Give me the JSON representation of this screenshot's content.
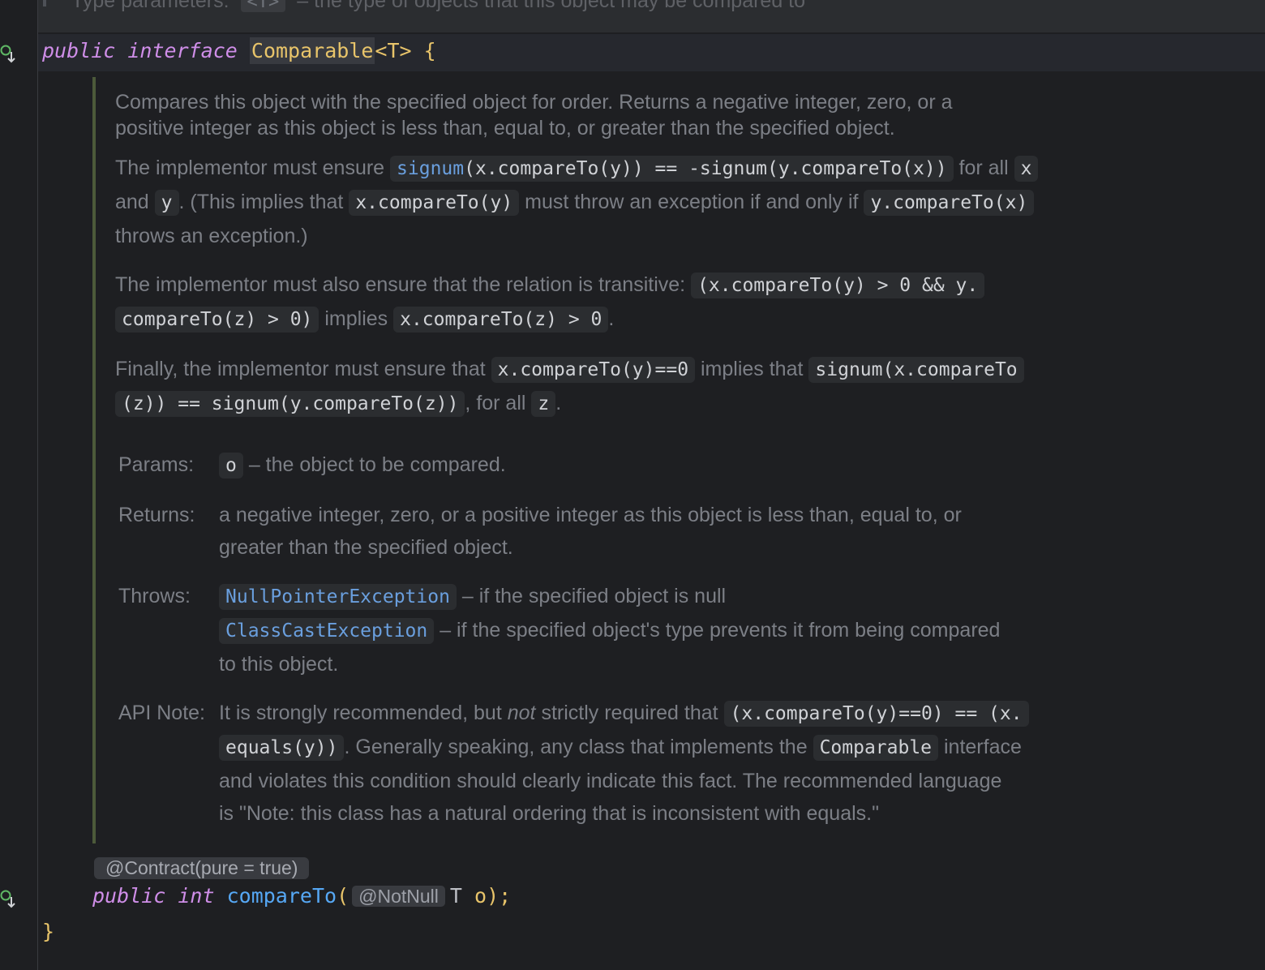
{
  "header": {
    "type_params_label": "Type parameters:",
    "type_params_code": "<T>",
    "type_params_desc": "– the type of objects that this object may be compared to"
  },
  "decl": {
    "kw_public": "public",
    "kw_interface": "interface",
    "class_name": "Comparable",
    "type_param": "<T>",
    "open_brace": "{"
  },
  "doc": {
    "p1_line1": "Compares this object with the specified object for order. Returns a negative integer, zero, or a",
    "p1_line2": "positive integer as this object is less than, equal to, or greater than the specified object.",
    "p2": {
      "t1": "The implementor must ensure",
      "c1_link": "signum",
      "c1_rest": "(x.compareTo(y)) == -signum(y.compareTo(x))",
      "t2": "for all",
      "c2": "x",
      "t3": "and",
      "c3": "y",
      "t4": ". (This implies that",
      "c4": "x.compareTo(y)",
      "t5": "must throw an exception if and only if",
      "c5": "y.compareTo(x)",
      "t6": "throws an exception.)"
    },
    "p3": {
      "t1": "The implementor must also ensure that the relation is transitive:",
      "c1a": "(x.compareTo(y) > 0 && y.",
      "c1b": "compareTo(z) > 0)",
      "t2": "implies",
      "c2": "x.compareTo(z) > 0",
      "t3": "."
    },
    "p4": {
      "t1": "Finally, the implementor must ensure that",
      "c1": "x.compareTo(y)==0",
      "t2": "implies that",
      "c2a": "signum(x.compareTo",
      "c2b": "(z)) == signum(y.compareTo(z))",
      "t3": ", for all",
      "c3": "z",
      "t4": "."
    },
    "params_label": "Params:",
    "params_code": "o",
    "params_desc": "– the object to be compared.",
    "returns_label": "Returns:",
    "returns_line1": "a negative integer, zero, or a positive integer as this object is less than, equal to, or",
    "returns_line2": "greater than the specified object.",
    "throws_label": "Throws:",
    "throws1_code": "NullPointerException",
    "throws1_desc": "– if the specified object is null",
    "throws2_code": "ClassCastException",
    "throws2_desc": "– if the specified object's type prevents it from being compared",
    "throws2_line2": "to this object.",
    "apinote_label": "API Note:",
    "apinote": {
      "t1": "It is strongly recommended, but",
      "em": "not",
      "t2": "strictly required that",
      "c1a": "(x.compareTo(y)==0) == (x.",
      "c1b": "equals(y))",
      "t3": ". Generally speaking, any class that implements the",
      "c2": "Comparable",
      "t4": "interface",
      "line3": "and violates this condition should clearly indicate this fact. The recommended language",
      "line4": "is \"Note: this class has a natural ordering that is inconsistent with equals.\""
    }
  },
  "method": {
    "annotation": "@Contract(pure = true)",
    "kw_public": "public",
    "kw_int": "int",
    "name": "compareTo",
    "open_paren": "(",
    "param_annotation": "@NotNull",
    "param_type": "T",
    "param_name": "o",
    "close": ");"
  },
  "closing_brace": "}",
  "colors": {
    "background": "#1e1f22",
    "keyword": "#cf8ee8",
    "class": "#e8c46a",
    "method": "#56a8f5",
    "link": "#6a9fde",
    "doc_text": "#7c7f86"
  },
  "icons": {
    "gutter_line1": "implemented-down-arrow-icon",
    "gutter_line2": "implemented-down-arrow-icon"
  }
}
